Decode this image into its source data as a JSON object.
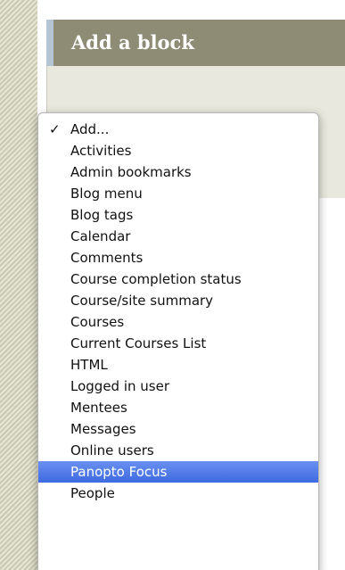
{
  "block": {
    "title": "Add a block"
  },
  "dropdown": {
    "check_glyph": "✓",
    "options": [
      {
        "label": "Add...",
        "checked": true
      },
      {
        "label": "Activities"
      },
      {
        "label": "Admin bookmarks"
      },
      {
        "label": "Blog menu"
      },
      {
        "label": "Blog tags"
      },
      {
        "label": "Calendar"
      },
      {
        "label": "Comments"
      },
      {
        "label": "Course completion status"
      },
      {
        "label": "Course/site summary"
      },
      {
        "label": "Courses"
      },
      {
        "label": "Current Courses List"
      },
      {
        "label": "HTML"
      },
      {
        "label": "Logged in user"
      },
      {
        "label": "Mentees"
      },
      {
        "label": "Messages"
      },
      {
        "label": "Online users"
      },
      {
        "label": "Panopto Focus",
        "highlighted": true
      },
      {
        "label": "People"
      }
    ]
  },
  "colors": {
    "header_bg": "#8e8c75",
    "highlight": "#4f7be8",
    "stripe": "#d8d8c4"
  }
}
